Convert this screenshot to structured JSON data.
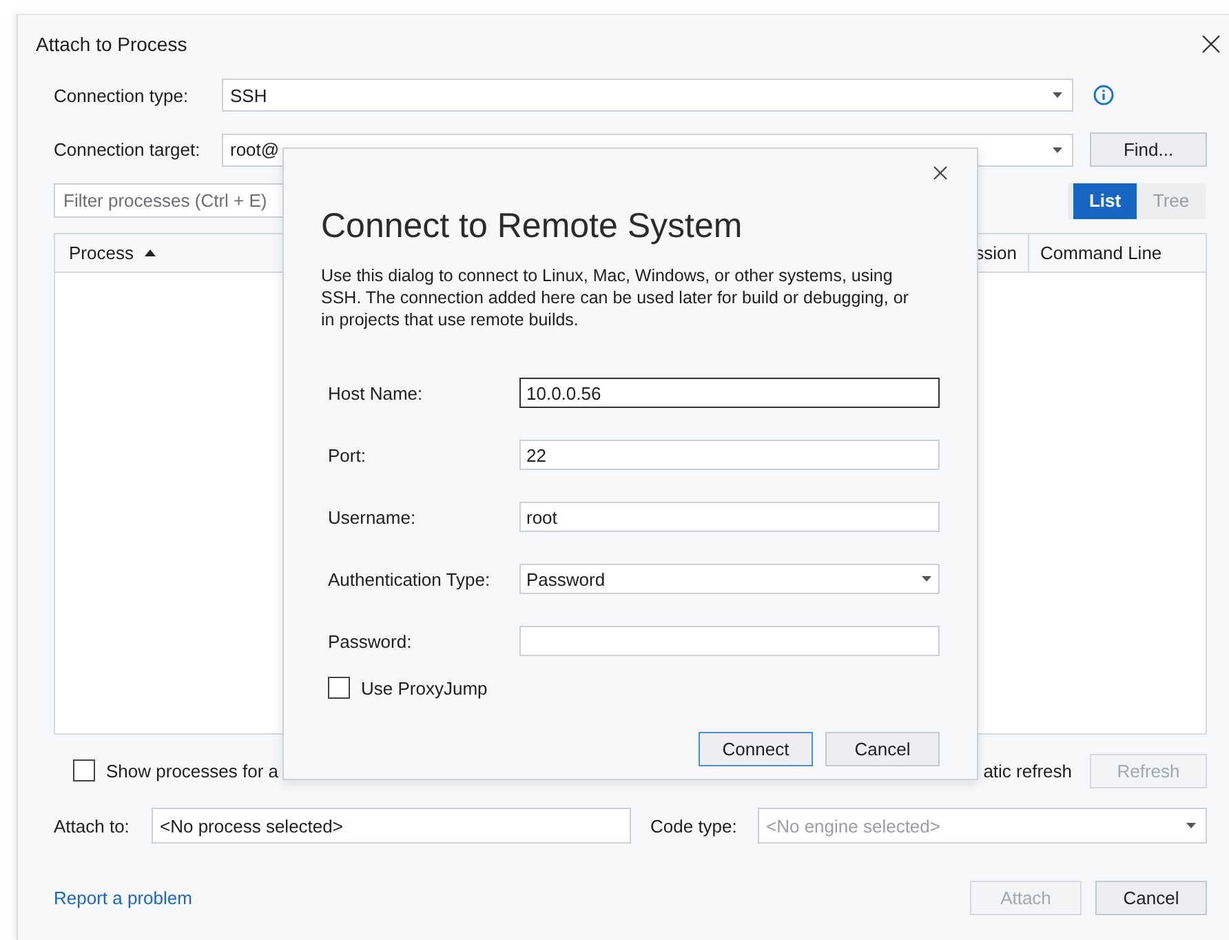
{
  "window": {
    "title": "Attach to Process"
  },
  "connection_type": {
    "label": "Connection type:",
    "value": "SSH"
  },
  "connection_target": {
    "label": "Connection target:",
    "value": "root@"
  },
  "find_button": {
    "label": "Find..."
  },
  "filter": {
    "placeholder": "Filter processes (Ctrl + E)"
  },
  "view_toggle": [
    {
      "label": "List",
      "selected": true
    },
    {
      "label": "Tree",
      "selected": false
    }
  ],
  "table": {
    "columns": [
      {
        "label": "Process",
        "sorted": true
      },
      {
        "label": "ssion",
        "sorted": false
      },
      {
        "label": "Command Line",
        "sorted": false
      }
    ]
  },
  "show_processes": {
    "label": "Show processes for a",
    "checked": false
  },
  "auto_refresh": {
    "label": "atic refresh"
  },
  "refresh_button": {
    "label": "Refresh",
    "disabled": true
  },
  "attach_to": {
    "label": "Attach to:",
    "value": "<No process selected>"
  },
  "code_type": {
    "label": "Code type:",
    "value": "<No engine selected>",
    "disabled": true
  },
  "report_link": {
    "label": "Report a problem"
  },
  "footer_buttons": [
    {
      "label": "Attach",
      "disabled": true
    },
    {
      "label": "Cancel",
      "disabled": false
    }
  ],
  "modal": {
    "title": "Connect to Remote System",
    "description": "Use this dialog to connect to Linux, Mac, Windows, or other systems, using SSH. The connection added here can be used later for build or debugging, or in projects that use remote builds.",
    "fields": [
      {
        "kind": "text",
        "label": "Host Name:",
        "value": "10.0.0.56",
        "focused": true
      },
      {
        "kind": "text",
        "label": "Port:",
        "value": "22",
        "focused": false
      },
      {
        "kind": "text",
        "label": "Username:",
        "value": "root",
        "focused": false
      },
      {
        "kind": "select",
        "label": "Authentication Type:",
        "value": "Password",
        "focused": false
      },
      {
        "kind": "text",
        "label": "Password:",
        "focused": false
      }
    ],
    "proxy_jump": {
      "label": "Use ProxyJump",
      "checked": false
    },
    "buttons": [
      {
        "label": "Connect",
        "default": true
      },
      {
        "label": "Cancel",
        "default": false
      }
    ]
  }
}
